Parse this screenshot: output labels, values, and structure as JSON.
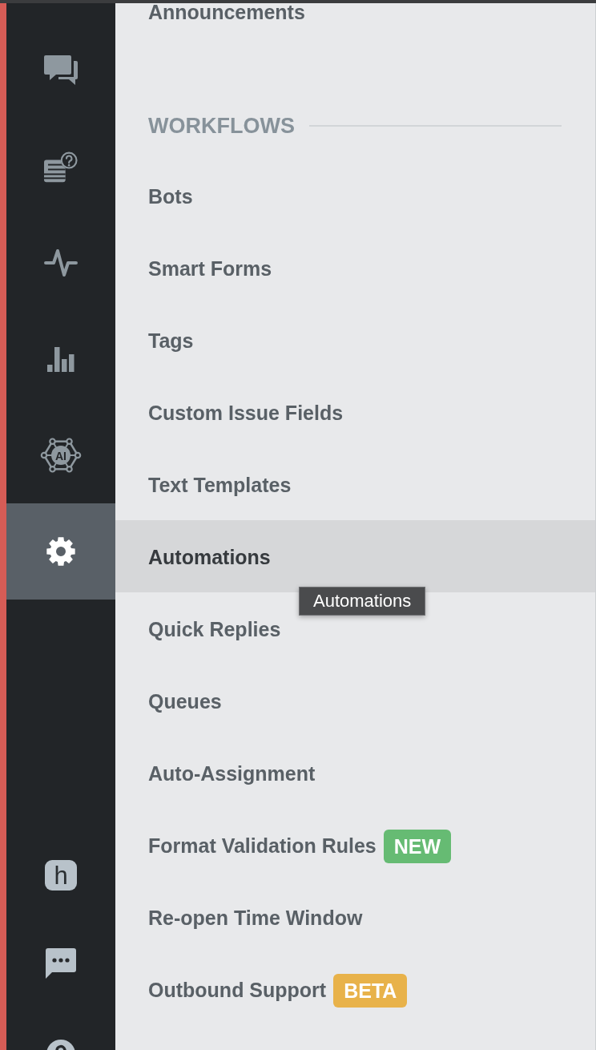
{
  "rail": {
    "top_items": [
      {
        "selected": false
      },
      {
        "selected": false
      },
      {
        "selected": false
      },
      {
        "selected": false
      },
      {
        "selected": false,
        "icon_text": "AI"
      },
      {
        "selected": true
      }
    ],
    "bottom_items": [
      {
        "selected": false,
        "icon_text": "h"
      },
      {
        "selected": false
      },
      {
        "selected": false
      }
    ]
  },
  "menu": {
    "sections": [
      {
        "items": [
          {
            "label": "Announcements",
            "hovered": false
          }
        ]
      },
      {
        "title": "WORKFLOWS",
        "items": [
          {
            "label": "Bots",
            "hovered": false
          },
          {
            "label": "Smart Forms",
            "hovered": false
          },
          {
            "label": "Tags",
            "hovered": false
          },
          {
            "label": "Custom Issue Fields",
            "hovered": false
          },
          {
            "label": "Text Templates",
            "hovered": false
          },
          {
            "label": "Automations",
            "hovered": true
          },
          {
            "label": "Quick Replies",
            "hovered": false
          },
          {
            "label": "Queues",
            "hovered": false
          },
          {
            "label": "Auto-Assignment",
            "hovered": false
          },
          {
            "label": "Format Validation Rules",
            "hovered": false,
            "badge": {
              "text": "NEW",
              "color": "#66bb73"
            }
          },
          {
            "label": "Re-open Time Window",
            "hovered": false
          },
          {
            "label": "Outbound Support",
            "hovered": false,
            "badge": {
              "text": "BETA",
              "color": "#e8b24a"
            }
          }
        ]
      }
    ],
    "tooltip": {
      "text": "Automations"
    }
  }
}
